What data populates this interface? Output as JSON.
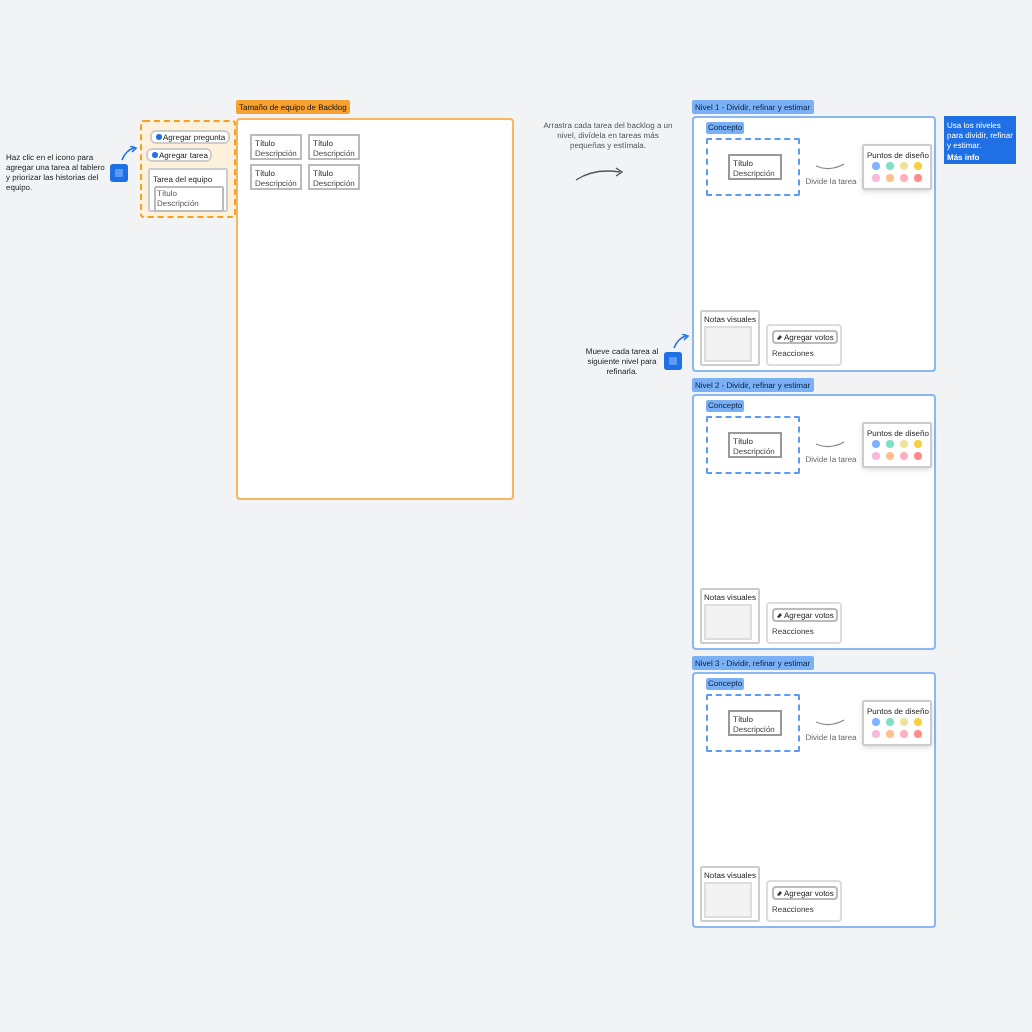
{
  "left_note": {
    "text": "Haz clic en el icono para agregar una tarea al tablero y priorizar las historias del equipo."
  },
  "toolkit": {
    "buttons": [
      "Agregar pregunta",
      "Agregar tarea"
    ],
    "card_title": "Tarea del equipo",
    "field_placeholder": "Título",
    "field_hint": "Descripción"
  },
  "backlog": {
    "title": "Tamaño de equipo de Backlog",
    "cards": [
      {
        "title": "Título",
        "subtitle": "Descripción"
      },
      {
        "title": "Título",
        "subtitle": "Descripción"
      },
      {
        "title": "Título",
        "subtitle": "Descripción"
      },
      {
        "title": "Título",
        "subtitle": "Descripción"
      }
    ]
  },
  "middle_note": "Arrastra cada tarea del backlog a un nivel, divídela en tareas más pequeñas y estímala.",
  "side_note": "Mueve cada tarea al siguiente nivel para refinarla.",
  "info_note": {
    "text": "Usa los niveles para dividir, refinar y estimar.",
    "link": "Más info"
  },
  "levels": [
    {
      "title": "Nivel 1 - Dividir, refinar y estimar",
      "tag": "Concepto",
      "card_title": "Título",
      "card_subtitle": "Descripción",
      "caption": "Divide la tarea",
      "points_title": "Puntos de diseño",
      "notes_title": "Notas visuales",
      "vote_button": "Agregar votos",
      "reactions": "Reacciones"
    },
    {
      "title": "Nivel 2 - Dividir, refinar y estimar",
      "tag": "Concepto",
      "card_title": "Título",
      "card_subtitle": "Descripción",
      "caption": "Divide la tarea",
      "points_title": "Puntos de diseño",
      "notes_title": "Notas visuales",
      "vote_button": "Agregar votos",
      "reactions": "Reacciones"
    },
    {
      "title": "Nivel 3 - Dividir, refinar y estimar",
      "tag": "Concepto",
      "card_title": "Título",
      "card_subtitle": "Descripción",
      "caption": "Divide la tarea",
      "points_title": "Puntos de diseño",
      "notes_title": "Notas visuales",
      "vote_button": "Agregar votos",
      "reactions": "Reacciones"
    }
  ],
  "points": [
    {
      "color": "#7fb2ff"
    },
    {
      "color": "#7fe0c8"
    },
    {
      "color": "#efe29a"
    },
    {
      "color": "#f5d040"
    },
    {
      "color": "#f9b8d8"
    },
    {
      "color": "#ffc090"
    },
    {
      "color": "#ffb0c0"
    },
    {
      "color": "#ff8a8a"
    }
  ]
}
